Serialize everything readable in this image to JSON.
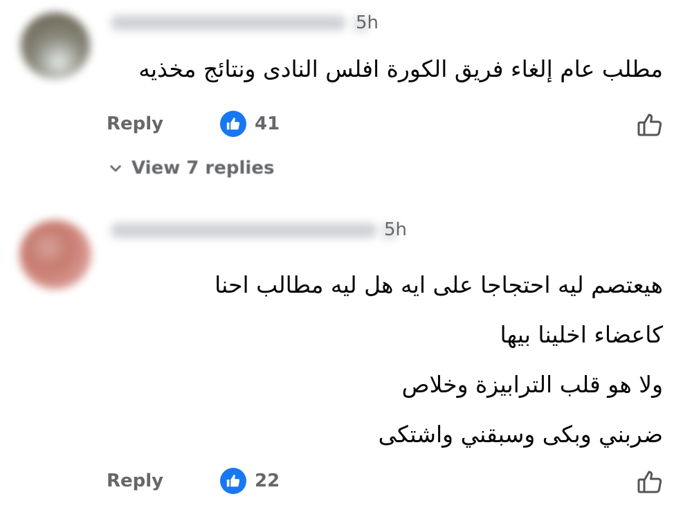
{
  "comments": [
    {
      "time": "5h",
      "lines": [
        "مطلب عام إلغاء فريق الكورة افلس النادى ونتائج مخذيه"
      ],
      "reply_label": "Reply",
      "reaction_count": "41",
      "view_replies_label": "View 7 replies"
    },
    {
      "time": "5h",
      "lines": [
        "هيعتصم ليه احتجاجا على ايه هل ليه مطالب احنا",
        "كاعضاء اخلينا بيها",
        "ولا هو قلب الترابيزة وخلاص",
        "ضربني وبكى وسبقني واشتكى"
      ],
      "reply_label": "Reply",
      "reaction_count": "22"
    }
  ],
  "icons": {
    "reaction": "like-reaction-icon",
    "like_button": "thumbs-up-outline-icon",
    "chevron": "chevron-down-icon"
  },
  "colors": {
    "reaction_blue": "#1877f2",
    "secondary_text": "#65676b",
    "primary_text": "#050505"
  }
}
